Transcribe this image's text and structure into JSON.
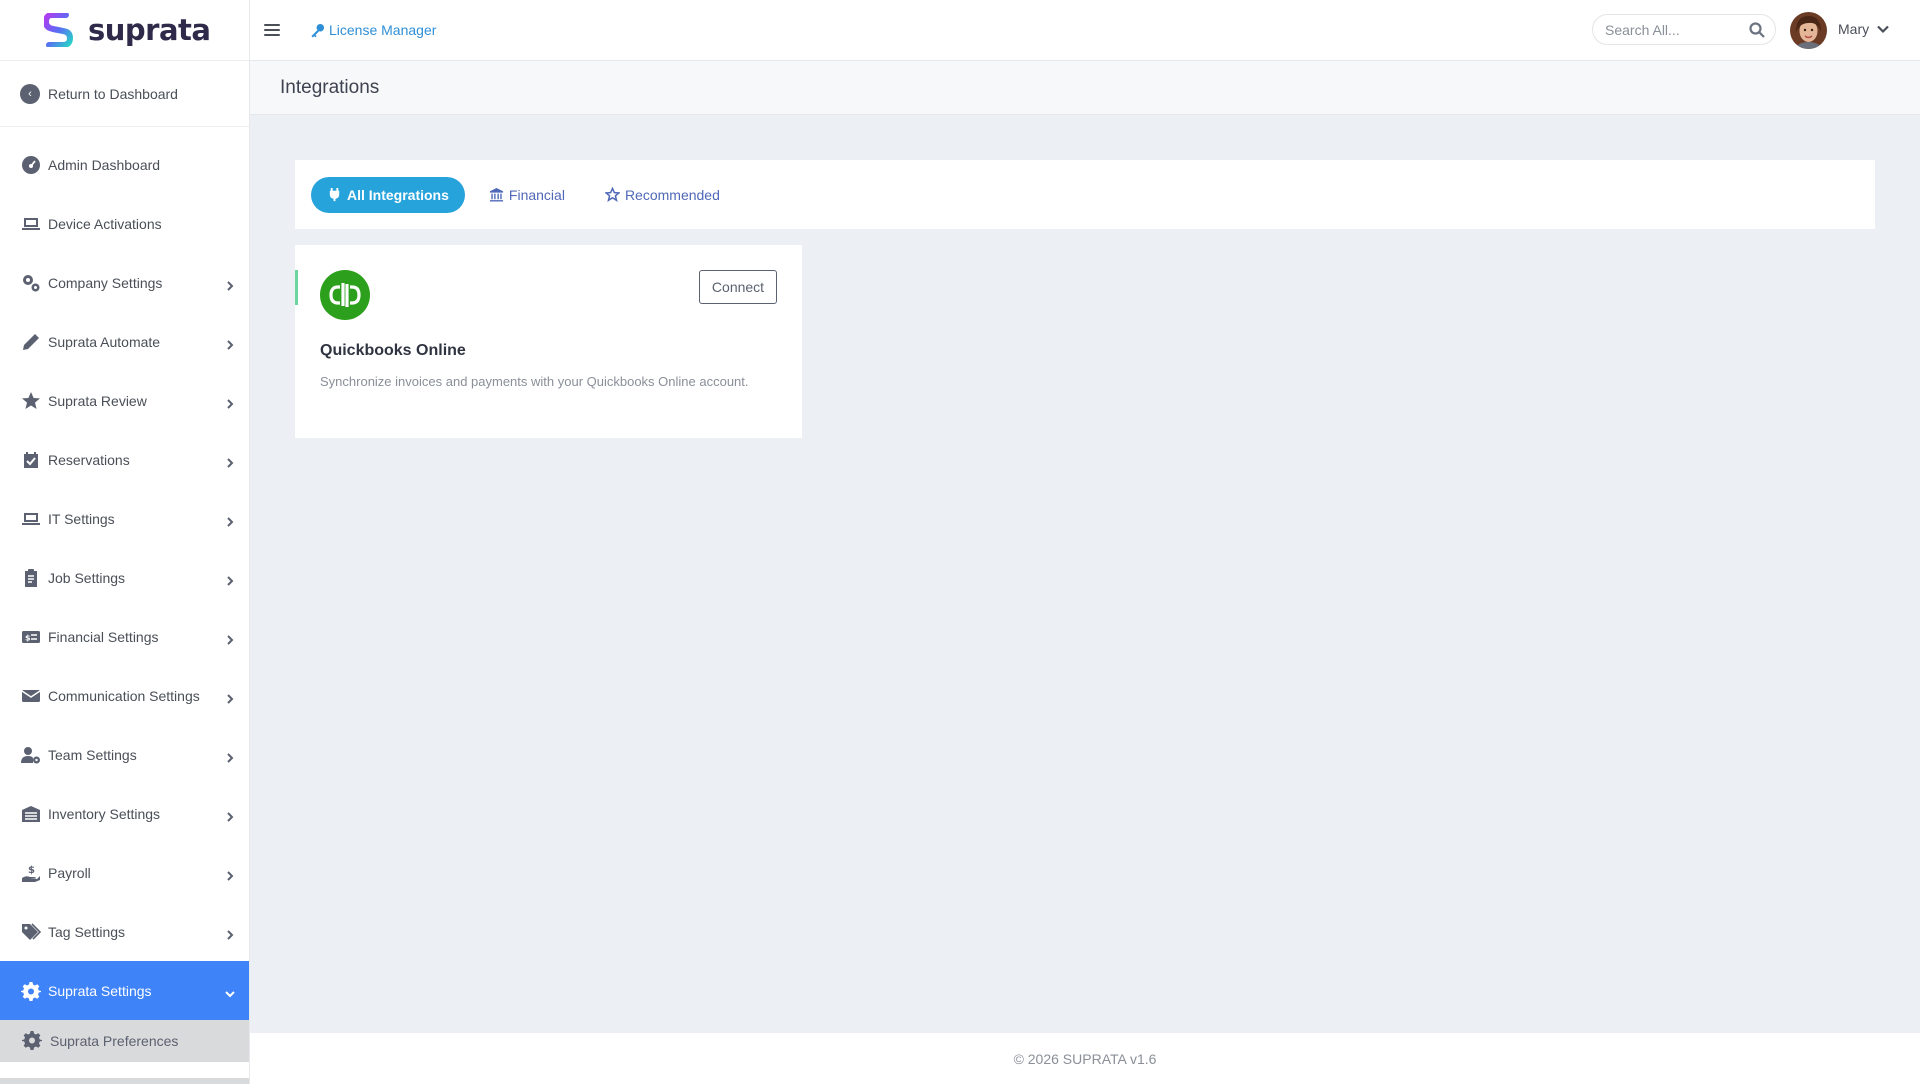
{
  "brand": {
    "name": "suprata"
  },
  "sidebar": {
    "return_label": "Return to Dashboard",
    "items": [
      {
        "label": "Admin Dashboard",
        "icon": "dashboard-icon",
        "has_chevron": false
      },
      {
        "label": "Device Activations",
        "icon": "laptop-icon",
        "has_chevron": false
      },
      {
        "label": "Company Settings",
        "icon": "gears-icon",
        "has_chevron": true
      },
      {
        "label": "Suprata Automate",
        "icon": "pencil-icon",
        "has_chevron": true
      },
      {
        "label": "Suprata Review",
        "icon": "star-icon",
        "has_chevron": true
      },
      {
        "label": "Reservations",
        "icon": "calendar-check-icon",
        "has_chevron": true
      },
      {
        "label": "IT Settings",
        "icon": "laptop-icon",
        "has_chevron": true
      },
      {
        "label": "Job Settings",
        "icon": "clipboard-icon",
        "has_chevron": true
      },
      {
        "label": "Financial Settings",
        "icon": "money-card-icon",
        "has_chevron": true
      },
      {
        "label": "Communication Settings",
        "icon": "envelope-icon",
        "has_chevron": true
      },
      {
        "label": "Team Settings",
        "icon": "user-gear-icon",
        "has_chevron": true
      },
      {
        "label": "Inventory Settings",
        "icon": "warehouse-icon",
        "has_chevron": true
      },
      {
        "label": "Payroll",
        "icon": "hand-dollar-icon",
        "has_chevron": true
      },
      {
        "label": "Tag Settings",
        "icon": "tags-icon",
        "has_chevron": true
      },
      {
        "label": "Suprata Settings",
        "icon": "gear-icon",
        "has_chevron": true,
        "active": true
      }
    ],
    "sub_items": [
      {
        "label": "Suprata Preferences",
        "icon": "gear-icon"
      }
    ]
  },
  "header": {
    "license_label": "License Manager",
    "search_placeholder": "Search All...",
    "user_name": "Mary"
  },
  "page": {
    "title": "Integrations"
  },
  "tabs": [
    {
      "label": "All Integrations",
      "icon": "plug-icon",
      "active": true
    },
    {
      "label": "Financial",
      "icon": "bank-icon",
      "active": false
    },
    {
      "label": "Recommended",
      "icon": "star-outline-icon",
      "active": false
    }
  ],
  "integrations": [
    {
      "name": "Quickbooks Online",
      "description": "Synchronize invoices and payments with your Quickbooks Online account.",
      "button_label": "Connect",
      "logo_color": "#2ca01c"
    }
  ],
  "footer": {
    "text": "© 2026 SUPRATA v1.6"
  },
  "colors": {
    "accent_blue": "#3f83f8",
    "tab_active": "#27a3dc",
    "link": "#2f8fd6"
  }
}
